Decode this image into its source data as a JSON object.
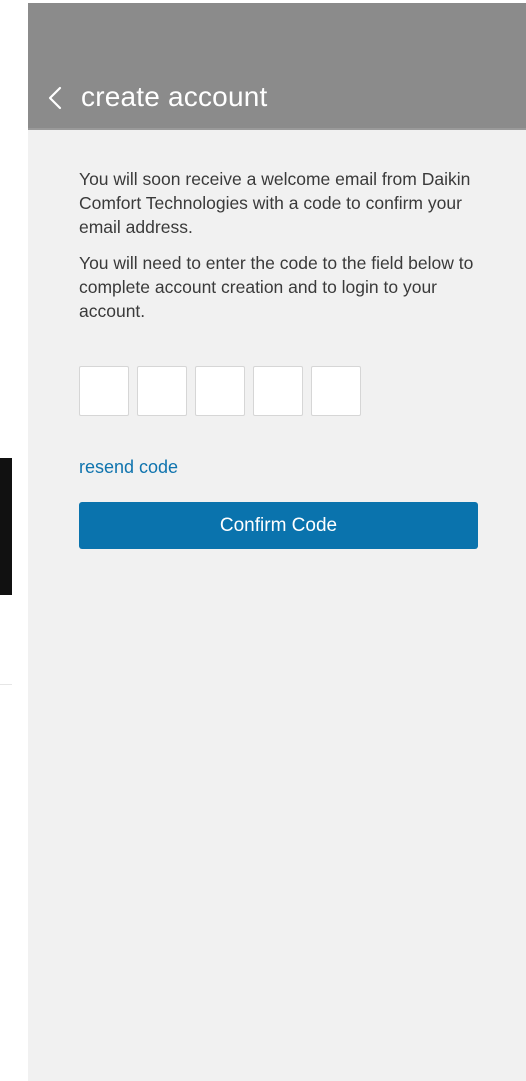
{
  "header": {
    "title": "create account",
    "back_icon": "chevron-left-icon",
    "background_color": "#8b8b8b",
    "title_color": "#ffffff"
  },
  "content": {
    "paragraph_1": "You will soon receive a welcome  email from Daikin Comfort Technologies with a code to confirm your email address.",
    "paragraph_2": "You will need to enter the code to the field below to complete account creation and to login to your account."
  },
  "code_inputs": [
    {
      "value": ""
    },
    {
      "value": ""
    },
    {
      "value": ""
    },
    {
      "value": ""
    },
    {
      "value": ""
    }
  ],
  "resend_link_label": "resend code",
  "confirm_button_label": "Confirm Code",
  "colors": {
    "accent": "#0a73ad",
    "link": "#0f74ae",
    "page_background": "#f1f1f1",
    "text": "#3a3a3a"
  }
}
